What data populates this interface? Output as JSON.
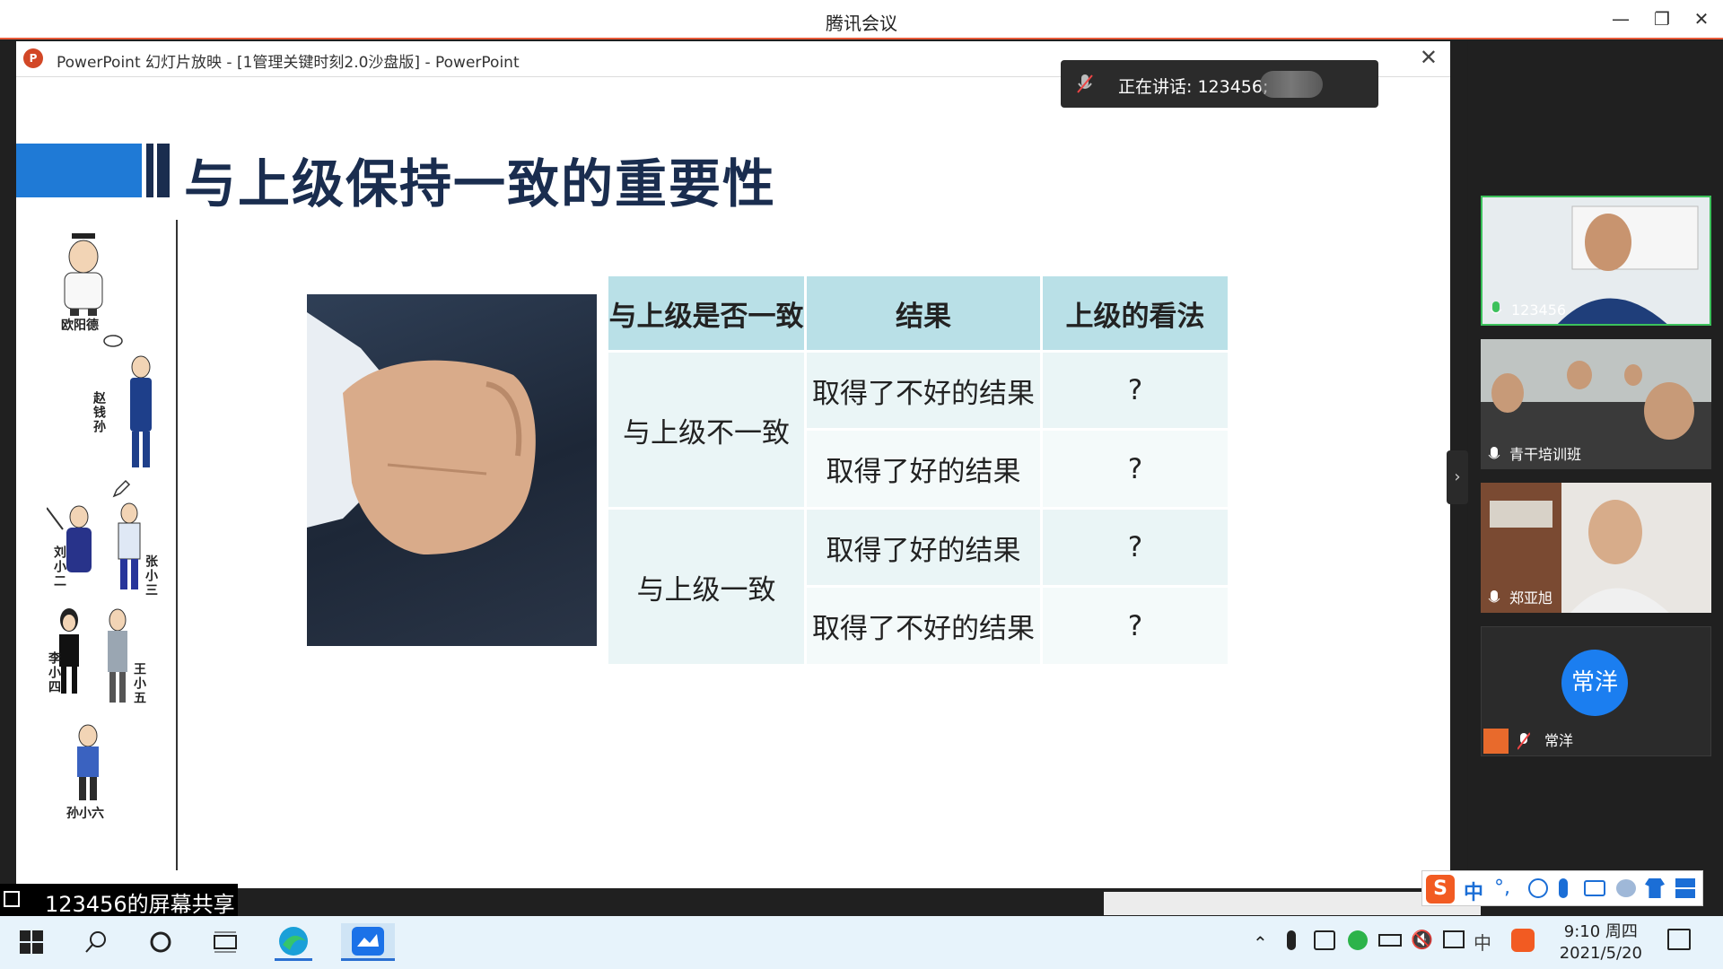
{
  "window": {
    "title": "腾讯会议"
  },
  "ppt": {
    "window_title": "PowerPoint 幻灯片放映 - [1管理关键时刻2.0沙盘版] - PowerPoint",
    "logo": "P"
  },
  "toast": {
    "speaking": "正在讲话: 123456;"
  },
  "slide": {
    "title": "与上级保持一致的重要性",
    "characters": [
      {
        "name": "欧阳德"
      },
      {
        "name": "赵钱孙"
      },
      {
        "name": "刘小二"
      },
      {
        "name": "张小三"
      },
      {
        "name": "李小四"
      },
      {
        "name": "王小五"
      },
      {
        "name": "孙小六"
      }
    ],
    "table": {
      "headers": [
        "与上级是否一致",
        "结果",
        "上级的看法"
      ],
      "groups": [
        {
          "label": "与上级不一致",
          "rows": [
            {
              "result": "取得了不好的结果",
              "view": "?"
            },
            {
              "result": "取得了好的结果",
              "view": "?"
            }
          ]
        },
        {
          "label": "与上级一致",
          "rows": [
            {
              "result": "取得了好的结果",
              "view": "?"
            },
            {
              "result": "取得了不好的结果",
              "view": "?"
            }
          ]
        }
      ]
    }
  },
  "participants": [
    {
      "name": "123456",
      "mic": "green-mic-icon"
    },
    {
      "name": "青干培训班",
      "mic": "mic-icon"
    },
    {
      "name": "郑亚旭",
      "mic": "mic-icon"
    },
    {
      "name": "常洋",
      "avatar": "常洋",
      "mic": "mic-muted-icon"
    }
  ],
  "share_label": "123456的屏幕共享",
  "ime": {
    "lang": "中",
    "punct": "°,"
  },
  "taskbar": {
    "time": "9:10 周四",
    "date": "2021/5/20",
    "ime_indicator": "中"
  }
}
